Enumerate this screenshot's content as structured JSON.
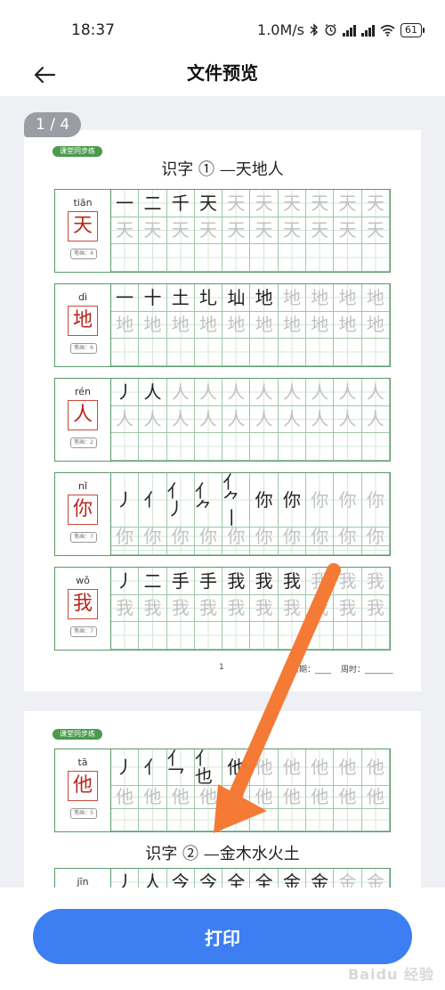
{
  "status_bar": {
    "time": "18:37",
    "network_speed": "1.0M/s",
    "icons": [
      "bluetooth-icon",
      "alarm-icon",
      "hd-signal-icon",
      "hd-signal-icon",
      "wifi-icon",
      "battery-icon"
    ],
    "battery": "61"
  },
  "header": {
    "title": "文件预览",
    "back_icon": "arrow-left-icon"
  },
  "preview": {
    "page_counter": "1 / 4",
    "pages": [
      {
        "badge": "课堂同步练",
        "title": "识字 ① —天地人",
        "rows": [
          {
            "pinyin": "tiān",
            "char": "天",
            "strokes_label": "笔画：4",
            "stroke_cells": [
              {
                "t": "一",
                "r": "一"
              },
              {
                "t": "二",
                "r": "一"
              },
              {
                "t": "千",
                "r": "丿"
              },
              {
                "t": "天",
                "r": "㇏"
              }
            ],
            "trace": "天"
          },
          {
            "pinyin": "dì",
            "char": "地",
            "strokes_label": "笔画：6",
            "stroke_cells": [
              {
                "t": "一",
                "r": "一"
              },
              {
                "t": "十",
                "r": "丨"
              },
              {
                "t": "土",
                "r": "一"
              },
              {
                "t": "圠",
                "r": "乛"
              },
              {
                "t": "圸",
                "r": "丨"
              },
              {
                "t": "地",
                "r": "乚"
              }
            ],
            "trace": "地"
          },
          {
            "pinyin": "rén",
            "char": "人",
            "strokes_label": "笔画：2",
            "stroke_cells": [
              {
                "t": "丿",
                "r": "丿"
              },
              {
                "t": "人",
                "r": "㇏"
              }
            ],
            "trace": "人"
          },
          {
            "pinyin": "nǐ",
            "char": "你",
            "strokes_label": "笔画：7",
            "stroke_cells": [
              {
                "t": "丿",
                "r": "丿"
              },
              {
                "t": "亻",
                "r": "丨"
              },
              {
                "t": "亻丿",
                "r": "丿"
              },
              {
                "t": "亻⺈",
                "r": "乛"
              },
              {
                "t": "亻⺈丨",
                "r": "亅"
              },
              {
                "t": "你",
                "r": "丶"
              },
              {
                "t": "你",
                "r": "丶"
              }
            ],
            "trace": "你"
          },
          {
            "pinyin": "wǒ",
            "char": "我",
            "strokes_label": "笔画：7",
            "stroke_cells": [
              {
                "t": "丿",
                "r": "丿"
              },
              {
                "t": "二",
                "r": "一"
              },
              {
                "t": "手",
                "r": "亅"
              },
              {
                "t": "手",
                "r": "一"
              },
              {
                "t": "我",
                "r": "戈"
              },
              {
                "t": "我",
                "r": "丿"
              },
              {
                "t": "我",
                "r": "丶"
              }
            ],
            "trace": "我"
          }
        ],
        "footer": {
          "page_number": "1",
          "date_label": "日期：____",
          "weekday_label": "周时：_______"
        }
      },
      {
        "badge": "课堂同步练",
        "rows": [
          {
            "pinyin": "tā",
            "char": "他",
            "strokes_label": "笔画：5",
            "stroke_cells": [
              {
                "t": "丿",
                "r": "丿"
              },
              {
                "t": "亻",
                "r": "丨"
              },
              {
                "t": "亻乛",
                "r": "乛"
              },
              {
                "t": "亻也",
                "r": "丨"
              },
              {
                "t": "他",
                "r": "乚"
              }
            ],
            "trace": "他"
          }
        ],
        "section_title": "识字 ② —金木水火土",
        "next_pinyin": "jīn",
        "next_stroke_cells": [
          {
            "t": "丿",
            "r": "丿"
          },
          {
            "t": "人",
            "r": "㇏"
          },
          {
            "t": "今",
            "r": "一"
          },
          {
            "t": "今",
            "r": "一"
          },
          {
            "t": "全",
            "r": "丨"
          },
          {
            "t": "全",
            "r": "丶"
          },
          {
            "t": "金",
            "r": "丿"
          },
          {
            "t": "金",
            "r": "一"
          }
        ],
        "next_trace": "金"
      }
    ]
  },
  "annotation": {
    "arrow_color": "#f47a36"
  },
  "bottom": {
    "print_label": "打印",
    "watermark": "Baidu 经验"
  },
  "colors": {
    "primary": "#3d7ef2",
    "grid": "#5a9a6a",
    "char_red": "#b8281c"
  }
}
